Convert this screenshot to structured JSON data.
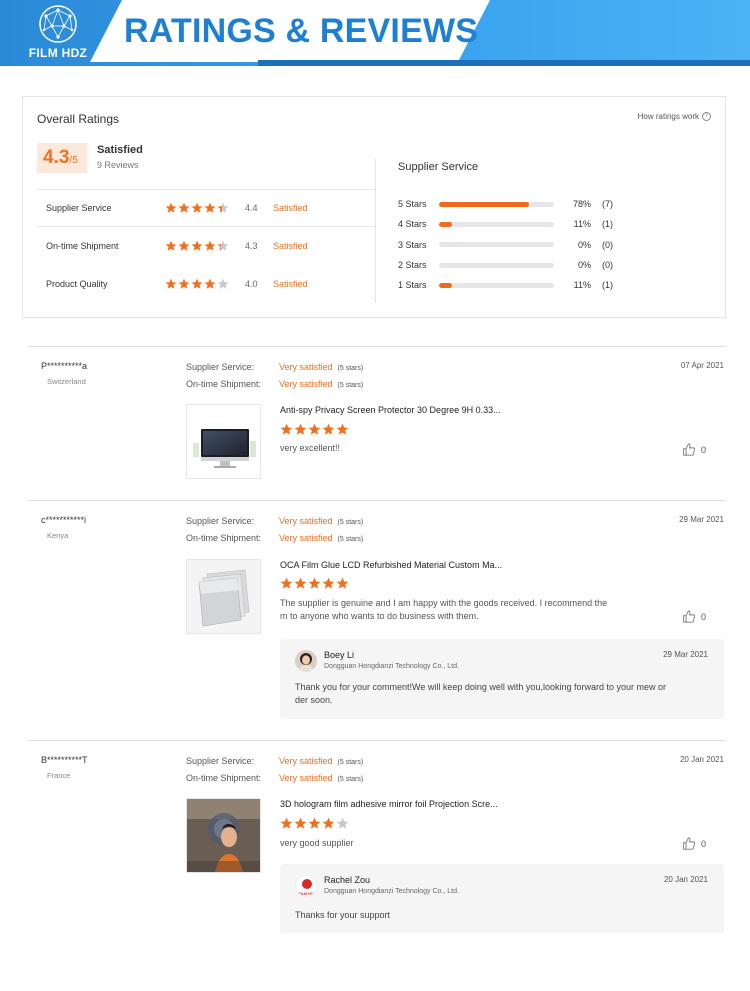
{
  "banner": {
    "logo_text": "FILM HDZ",
    "title": "RATINGS & REVIEWS"
  },
  "overall": {
    "title": "Overall Ratings",
    "how_ratings": "How ratings work",
    "score": "4.3",
    "score_of": "/5",
    "label": "Satisfied",
    "reviews": "9 Reviews",
    "categories": [
      {
        "name": "Supplier Service",
        "value": "4.4",
        "rating": 4.4,
        "label": "Satisfied"
      },
      {
        "name": "On-time Shipment",
        "value": "4.3",
        "rating": 4.3,
        "label": "Satisfied"
      },
      {
        "name": "Product Quality",
        "value": "4.0",
        "rating": 4.0,
        "label": "Satisfied"
      }
    ],
    "dist_title": "Supplier Service",
    "distribution": [
      {
        "label": "5 Stars",
        "pct": "78%",
        "count": "(7)",
        "fraction": 0.78
      },
      {
        "label": "4 Stars",
        "pct": "11%",
        "count": "(1)",
        "fraction": 0.11
      },
      {
        "label": "3 Stars",
        "pct": "0%",
        "count": "(0)",
        "fraction": 0
      },
      {
        "label": "2 Stars",
        "pct": "0%",
        "count": "(0)",
        "fraction": 0
      },
      {
        "label": "1 Stars",
        "pct": "11%",
        "count": "(1)",
        "fraction": 0.11
      }
    ]
  },
  "reviews": [
    {
      "user": "P**********a",
      "country": "Switzerland",
      "date": "07 Apr 2021",
      "attrs": [
        {
          "name": "Supplier Service:",
          "value": "Very satisfied",
          "stars": "(5 stars)"
        },
        {
          "name": "On-time Shipment:",
          "value": "Very satisfied",
          "stars": "(5 stars)"
        }
      ],
      "product": "Anti-spy Privacy Screen Protector 30 Degree 9H 0.33...",
      "rating": 5,
      "text": "very excellent!!",
      "likes": "0"
    },
    {
      "user": "c***********i",
      "country": "Kenya",
      "date": "29 Mar 2021",
      "attrs": [
        {
          "name": "Supplier Service:",
          "value": "Very satisfied",
          "stars": "(5 stars)"
        },
        {
          "name": "On-time Shipment:",
          "value": "Very satisfied",
          "stars": "(5 stars)"
        }
      ],
      "product": "OCA Film Glue LCD Refurbished Material Custom Ma...",
      "rating": 5,
      "text_line1": "The supplier is genuine and I am happy with the goods received. I recommend the",
      "text_line2": "m to anyone who wants to do business with them.",
      "likes": "0",
      "reply": {
        "name": "Boey Li",
        "company": "Dongguan Hongdianzi Technology Co., Ltd.",
        "date": "29 Mar 2021",
        "text_line1": "Thank you for your comment!We will keep doing well with you,looking forward to your mew or",
        "text_line2": "der soon."
      }
    },
    {
      "user": "B**********T",
      "country": "France",
      "date": "20 Jan 2021",
      "attrs": [
        {
          "name": "Supplier Service:",
          "value": "Very satisfied",
          "stars": "(5 stars)"
        },
        {
          "name": "On-time Shipment:",
          "value": "Very satisfied",
          "stars": "(5 stars)"
        }
      ],
      "product": "3D hologram film adhesive mirror foil Projection Scre...",
      "rating": 4,
      "text": "very good supplier",
      "likes": "0",
      "reply": {
        "name": "Rachel Zou",
        "company": "Dongguan Hongdianzi Technology Co., Ltd.",
        "date": "20 Jan 2021",
        "text": "Thanks for your support",
        "avatar_text": "FILM HDZ"
      }
    }
  ],
  "colors": {
    "accent": "#f07020",
    "banner_blue": "#2a8ad8",
    "star_empty": "#c8c8c8"
  }
}
